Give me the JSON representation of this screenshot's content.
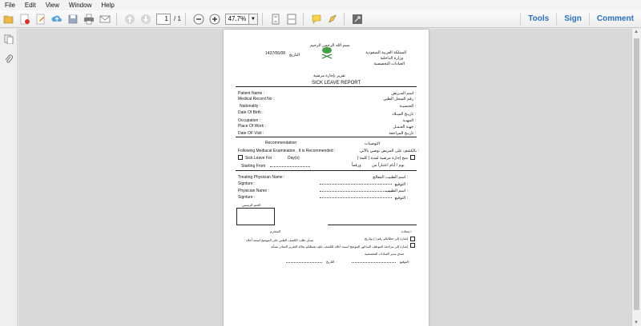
{
  "menu": [
    "File",
    "Edit",
    "View",
    "Window",
    "Help"
  ],
  "toolbar": {
    "page_current": "1",
    "page_total": "/ 1",
    "zoom": "47.7%",
    "zoom_dropdown": "▼"
  },
  "right_buttons": {
    "tools": "Tools",
    "sign": "Sign",
    "comment": "Comment"
  },
  "doc": {
    "basmala": "بسم الله الرحمن الرحيم",
    "kingdom": "المملكة العربية السعودية",
    "ministry": "وزارة الداخلية",
    "clinics": "العيادات التخصصية",
    "date_label": "التاريخ",
    "date_value": "1437/06/08",
    "title_ar": "تقرير بإجازة مرضية",
    "title_en": "SICK LEAVE REPORT",
    "fields": [
      {
        "en": "Patient Name :",
        "ar": "اسم المـريض :"
      },
      {
        "en": "Medical Record No :",
        "ar": "رقم السجل الطبي :"
      },
      {
        "en": "Nationality :",
        "ar": "الجنسيـة :"
      },
      {
        "en": "Date Of Birth :",
        "ar": "تاريـخ الميـلاد :"
      },
      {
        "en": "Occupation :",
        "ar": "المهنـة :"
      },
      {
        "en": "Place Of Work :",
        "ar": "جهـة العـمـل :"
      },
      {
        "en": "Date OF Visit :",
        "ar": "تاريـخ المراجعة :"
      }
    ],
    "recommendation_en": "Recommendation",
    "recommendation_ar": "التوصيات",
    "following_en": "Following Mediacal Examination , It is Recommended :",
    "following_ar": "بالكشف على المريض نوصي بالآتي :",
    "sick_leave_en": "Sick Leave For",
    "days_en": "Day(s)",
    "sick_leave_ar": "منح إجازة مرضية لمدة ( كلمة )",
    "starting_en": "Starting From",
    "starting_ar": "يوم / أيام اعتباراً من",
    "starting_ar2": "ورقماً",
    "treating_en": "Treating Physician Name :",
    "treating_ar": "اسم الطبيب المعالج :",
    "signature1_en": "Signture :",
    "signature1_ar": "التوقيع :",
    "physician_en": "Physician Name :",
    "physician_ar": "اسم الطبيب :",
    "signature2_en": "Signture :",
    "signature2_ar": "التوقيع :",
    "stamp_label": "الختم الرسمي",
    "footer_respect": "سعادة /",
    "footer_respected": "المحترم",
    "footer_line1": "إشارة إلى خطابكم رقم (       ) وتاريخ",
    "footer_line1b": "بشأن طلب الكشف الطبي على الموضح اسمه أعلاه",
    "footer_line2": "إشارة إلى مراجعة الموظف المذكور الموضح اسمه أعلاه للكشف عليه نحيطكم بحالة التقرير الصادر بشأنه",
    "footer_approved": "صدق مدير العيادات التخصصية",
    "footer_sign": "التوقيع :",
    "footer_date": "التاريخ :"
  }
}
